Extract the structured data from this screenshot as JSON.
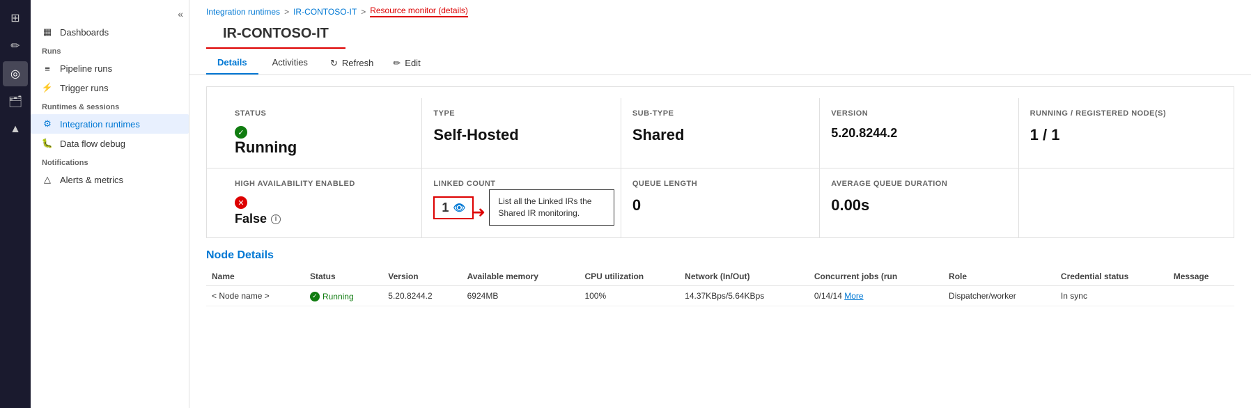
{
  "iconBar": {
    "items": [
      {
        "icon": "⊞",
        "label": "home",
        "active": false
      },
      {
        "icon": "✏",
        "label": "edit",
        "active": false
      },
      {
        "icon": "◎",
        "label": "monitor",
        "active": true
      },
      {
        "icon": "🗂",
        "label": "manage",
        "active": false
      },
      {
        "icon": "▲",
        "label": "deploy",
        "active": false
      }
    ]
  },
  "sidebar": {
    "dashboards_label": "Dashboards",
    "runs_label": "Runs",
    "pipeline_runs_label": "Pipeline runs",
    "trigger_runs_label": "Trigger runs",
    "runtimes_label": "Runtimes & sessions",
    "integration_runtimes_label": "Integration runtimes",
    "data_flow_debug_label": "Data flow debug",
    "notifications_label": "Notifications",
    "alerts_label": "Alerts & metrics"
  },
  "breadcrumb": {
    "part1": "Integration runtimes",
    "sep1": ">",
    "part2": "IR-CONTOSO-IT",
    "sep2": ">",
    "current": "Resource monitor (details)"
  },
  "page": {
    "title": "IR-CONTOSO-IT"
  },
  "tabs": {
    "details": "Details",
    "activities": "Activities",
    "refresh": "Refresh",
    "edit": "Edit"
  },
  "cards_row1": [
    {
      "label": "STATUS",
      "value": "Running",
      "has_check": true
    },
    {
      "label": "TYPE",
      "value": "Self-Hosted",
      "has_check": false
    },
    {
      "label": "SUB-TYPE",
      "value": "Shared",
      "has_check": false
    },
    {
      "label": "VERSION",
      "value": "5.20.8244.2",
      "has_check": false
    },
    {
      "label": "RUNNING / REGISTERED NODE(S)",
      "value": "1 / 1",
      "has_check": false
    }
  ],
  "cards_row2": [
    {
      "label": "HIGH AVAILABILITY ENABLED",
      "value": "False",
      "has_x": true,
      "has_info": true
    },
    {
      "label": "LINKED COUNT",
      "value": "1",
      "has_eye": true,
      "highlighted": true
    },
    {
      "label": "QUEUE LENGTH",
      "value": "0",
      "has_check": false
    },
    {
      "label": "AVERAGE QUEUE DURATION",
      "value": "0.00s",
      "has_check": false
    }
  ],
  "callout": {
    "text": "List all the Linked IRs the Shared IR monitoring."
  },
  "nodeDetails": {
    "title": "Node Details",
    "columns": [
      "Name",
      "Status",
      "Version",
      "Available memory",
      "CPU utilization",
      "Network (In/Out)",
      "Concurrent jobs (run",
      "Role",
      "Credential status",
      "Message"
    ],
    "rows": [
      {
        "name": "< Node name >",
        "status": "Running",
        "version": "5.20.8244.2",
        "memory": "6924MB",
        "cpu": "100%",
        "network": "14.37KBps/5.64KBps",
        "concurrent": "0/14/14",
        "more": "More",
        "role": "Dispatcher/worker",
        "credential": "In sync",
        "message": ""
      }
    ]
  }
}
